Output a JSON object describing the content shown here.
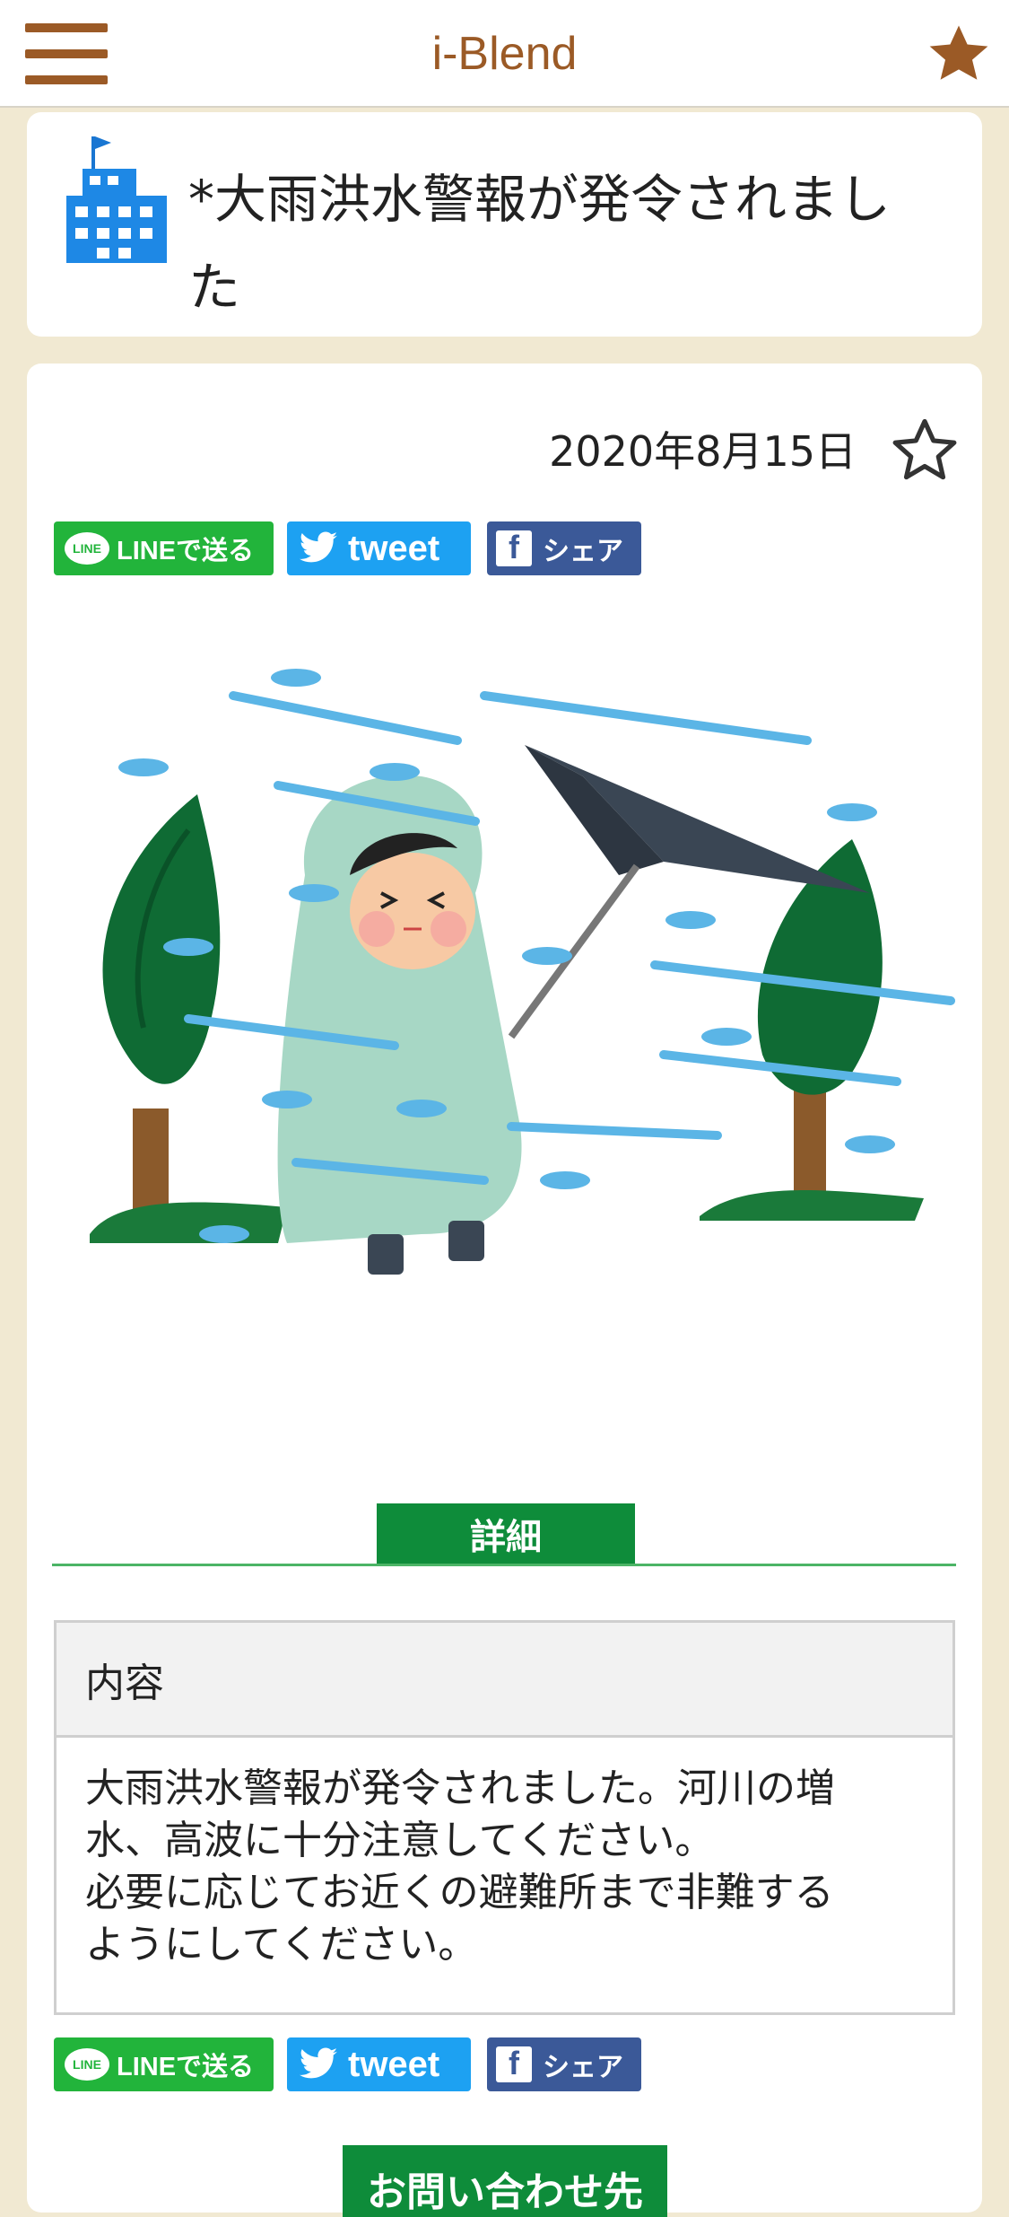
{
  "header": {
    "title": "i-Blend"
  },
  "article": {
    "title": "*大雨洪水警報が発令されました",
    "date": "2020年8月15日"
  },
  "share": {
    "line_label": "LINEで送る",
    "tweet_label": "tweet",
    "fb_label": "シェア"
  },
  "detail_tab_label": "詳細",
  "content": {
    "header": "内容",
    "body_line1": "大雨洪水警報が発令されました。河川の増",
    "body_line2": "水、高波に十分注意してください。",
    "body_line3": "必要に応じてお近くの避難所まで非難する",
    "body_line4": "ようにしてください。"
  },
  "contact_button_label": "お問い合わせ先",
  "colors": {
    "brand_brown": "#9b5a26",
    "background": "#f1e9d2",
    "green": "#0e8c3a",
    "line_green": "#22b43b",
    "twitter_blue": "#1da1f2",
    "facebook_blue": "#3b5998"
  },
  "icons": [
    "hamburger-menu-icon",
    "star-icon",
    "building-icon",
    "star-outline-icon",
    "line-icon",
    "twitter-icon",
    "facebook-icon"
  ]
}
